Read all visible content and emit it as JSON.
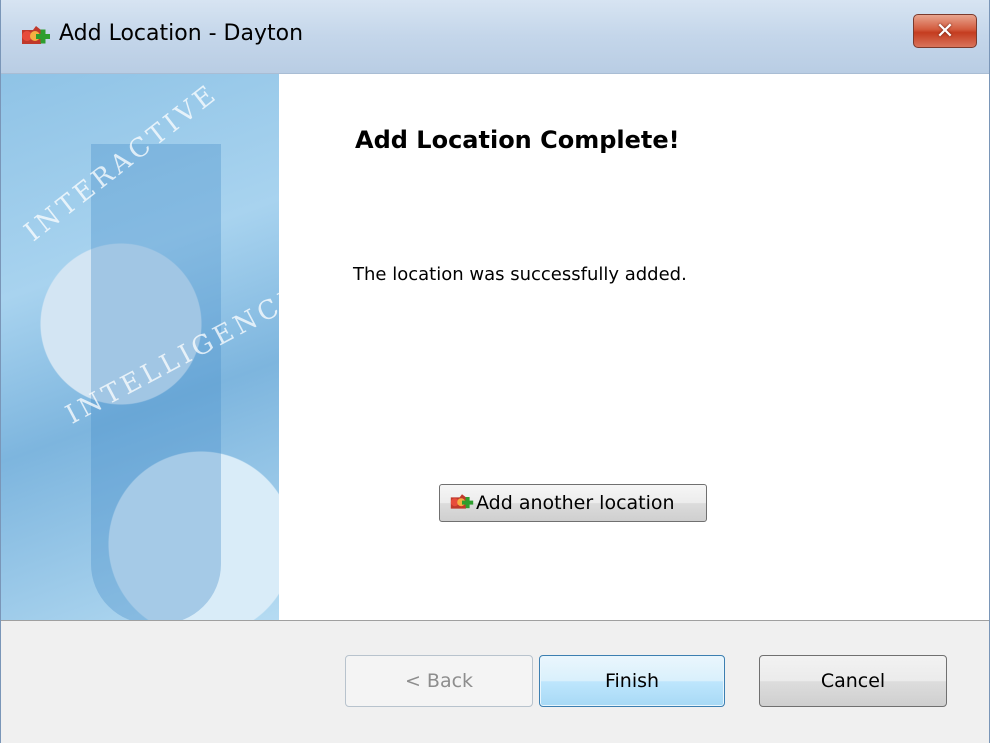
{
  "window": {
    "title": "Add Location - Dayton",
    "close_symbol": "✕",
    "app_icon": "add-location-icon"
  },
  "banner": {
    "words": [
      "INTERACTIVE",
      "INTELLIGENCE"
    ]
  },
  "content": {
    "heading": "Add Location Complete!",
    "message": "The location was successfully added.",
    "add_another_label": "Add another location",
    "add_another_icon": "add-location-icon"
  },
  "footer": {
    "back_label": "< Back",
    "finish_label": "Finish",
    "cancel_label": "Cancel"
  },
  "colors": {
    "finish_accent": "#a7d9f5",
    "close_button": "#c43c1f",
    "banner_blue": "#8fc3e6"
  }
}
